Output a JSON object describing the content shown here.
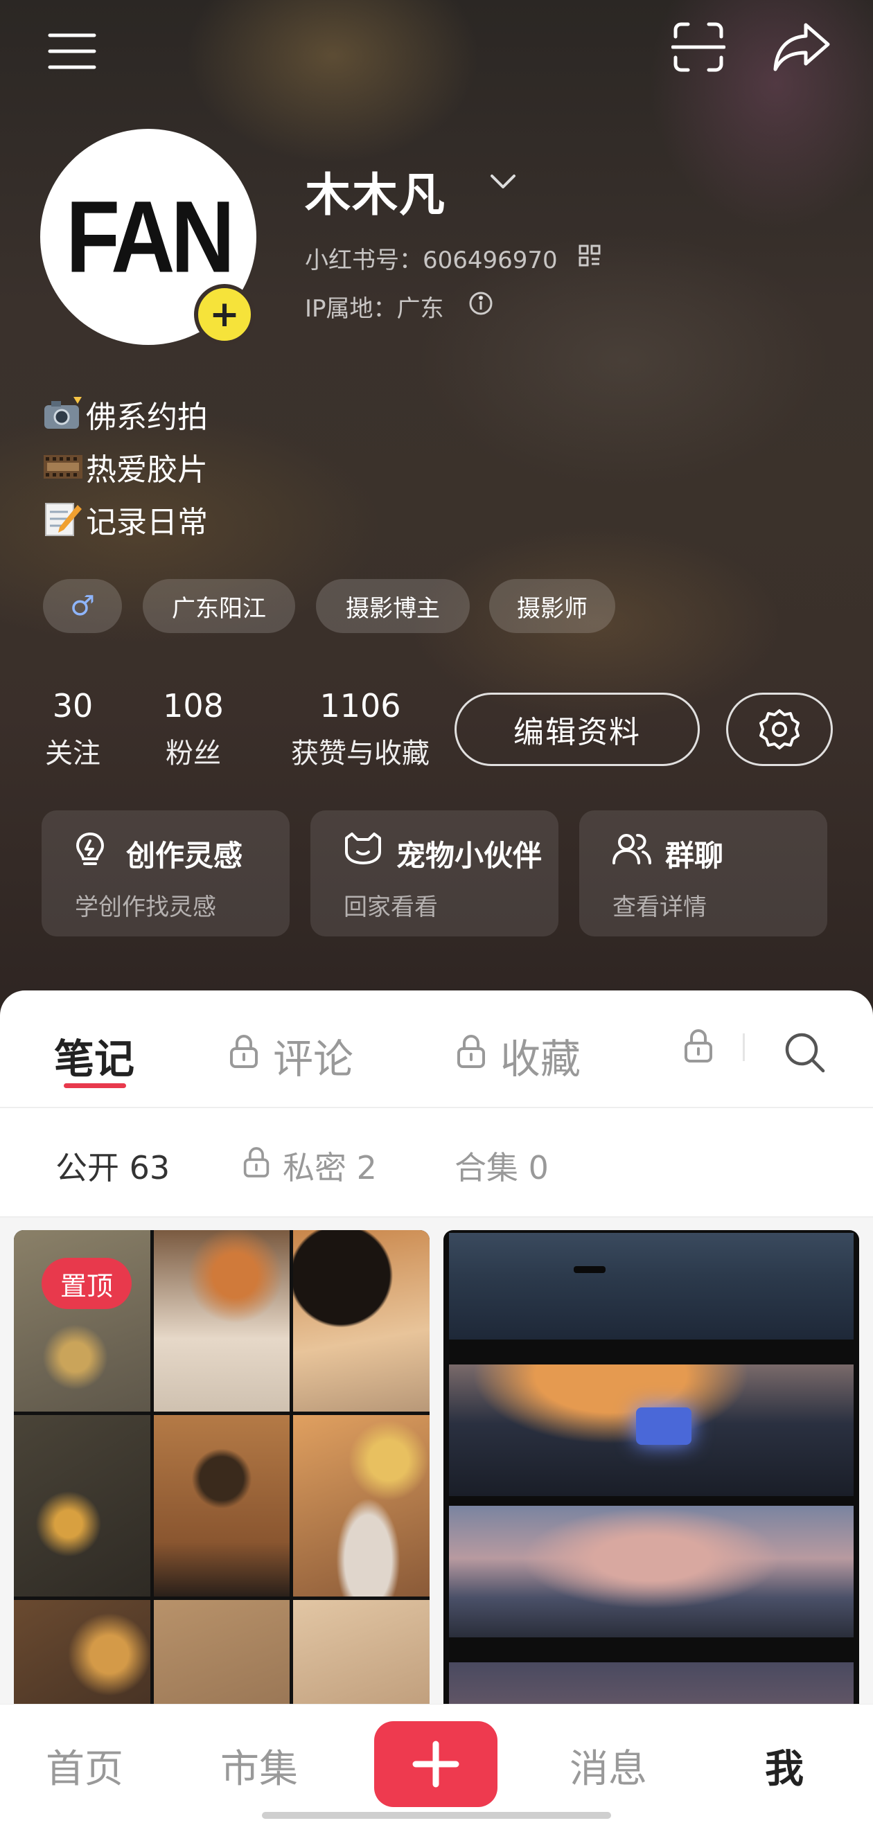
{
  "colors": {
    "accent": "#ee3a4f",
    "avatar_badge": "#f6e33a"
  },
  "top_bar": {
    "menu_icon": "hamburger-icon",
    "scan_icon": "scan-icon",
    "share_icon": "share-icon"
  },
  "profile": {
    "avatar_text": "FAN",
    "avatar_add_symbol": "+",
    "nickname": "木木凡",
    "id_label": "小红书号：606496970",
    "ip_label": "IP属地：广东"
  },
  "bio": {
    "lines": [
      "佛系约拍",
      "热爱胶片",
      "记录日常"
    ]
  },
  "tags": {
    "gender_symbol": "♂",
    "items": [
      "广东阳江",
      "摄影博主",
      "摄影师"
    ]
  },
  "stats": [
    {
      "value": "30",
      "label": "关注"
    },
    {
      "value": "108",
      "label": "粉丝"
    },
    {
      "value": "1106",
      "label": "获赞与收藏"
    }
  ],
  "actions": {
    "edit_profile": "编辑资料",
    "settings_icon": "gear-icon"
  },
  "cards": [
    {
      "title": "创作灵感",
      "subtitle": "学创作找灵感",
      "icon": "lightbulb-icon"
    },
    {
      "title": "宠物小伙伴",
      "subtitle": "回家看看",
      "icon": "pet-icon"
    },
    {
      "title": "群聊",
      "subtitle": "查看详情",
      "icon": "group-icon"
    }
  ],
  "tabs": [
    {
      "label": "笔记",
      "locked": false,
      "active": true
    },
    {
      "label": "评论",
      "locked": true,
      "active": false
    },
    {
      "label": "收藏",
      "locked": true,
      "active": false
    },
    {
      "label": "",
      "locked": true,
      "active": false
    }
  ],
  "subtabs": [
    {
      "label": "公开 63",
      "locked": false,
      "active": true
    },
    {
      "label": "私密 2",
      "locked": true,
      "active": false
    },
    {
      "label": "合集 0",
      "locked": false,
      "active": false
    }
  ],
  "notes": {
    "pinned_badge": "置顶"
  },
  "bottom_nav": {
    "home": "首页",
    "market": "市集",
    "add_symbol": "+",
    "messages": "消息",
    "me": "我"
  }
}
